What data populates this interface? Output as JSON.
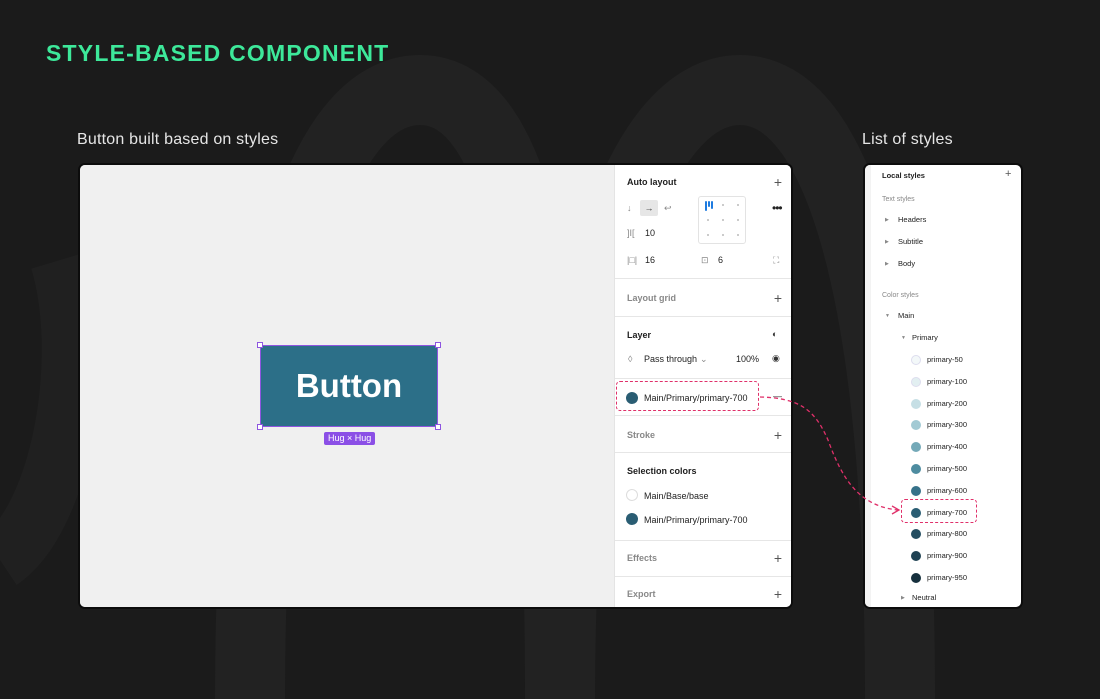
{
  "title": "STYLE-BASED COMPONENT",
  "captions": {
    "left": "Button built based on styles",
    "right": "List of styles"
  },
  "canvas": {
    "button_text": "Button",
    "hug_badge": "Hug × Hug"
  },
  "panel": {
    "auto_layout": {
      "title": "Auto layout",
      "gap": "10",
      "padding_h": "16",
      "padding_v": "6"
    },
    "layout_grid": {
      "title": "Layout grid"
    },
    "layer": {
      "title": "Layer",
      "blend_mode": "Pass through",
      "opacity": "100%"
    },
    "fill": {
      "style_name": "Main/Primary/primary-700",
      "color": "#2a5d73"
    },
    "stroke": {
      "title": "Stroke"
    },
    "selection_colors": {
      "title": "Selection colors",
      "items": [
        {
          "label": "Main/Base/base",
          "color": "#ffffff"
        },
        {
          "label": "Main/Primary/primary-700",
          "color": "#2a5d73"
        }
      ]
    },
    "effects": {
      "title": "Effects"
    },
    "export": {
      "title": "Export"
    }
  },
  "local_styles": {
    "title": "Local styles",
    "text_styles_title": "Text styles",
    "text_styles": [
      "Headers",
      "Subtitle",
      "Body"
    ],
    "color_styles_title": "Color styles",
    "group_main": "Main",
    "group_primary": "Primary",
    "colors": [
      {
        "name": "primary-50",
        "color": "#f3f8f9"
      },
      {
        "name": "primary-100",
        "color": "#e2eff1"
      },
      {
        "name": "primary-200",
        "color": "#c6dfe5"
      },
      {
        "name": "primary-300",
        "color": "#a2cad4"
      },
      {
        "name": "primary-400",
        "color": "#74a9b8"
      },
      {
        "name": "primary-500",
        "color": "#4e8ca0"
      },
      {
        "name": "primary-600",
        "color": "#36728a"
      },
      {
        "name": "primary-700",
        "color": "#2a5d73"
      },
      {
        "name": "primary-800",
        "color": "#244e61"
      },
      {
        "name": "primary-900",
        "color": "#1f4253"
      },
      {
        "name": "primary-950",
        "color": "#16303d"
      }
    ],
    "group_neutral": "Neutral"
  }
}
